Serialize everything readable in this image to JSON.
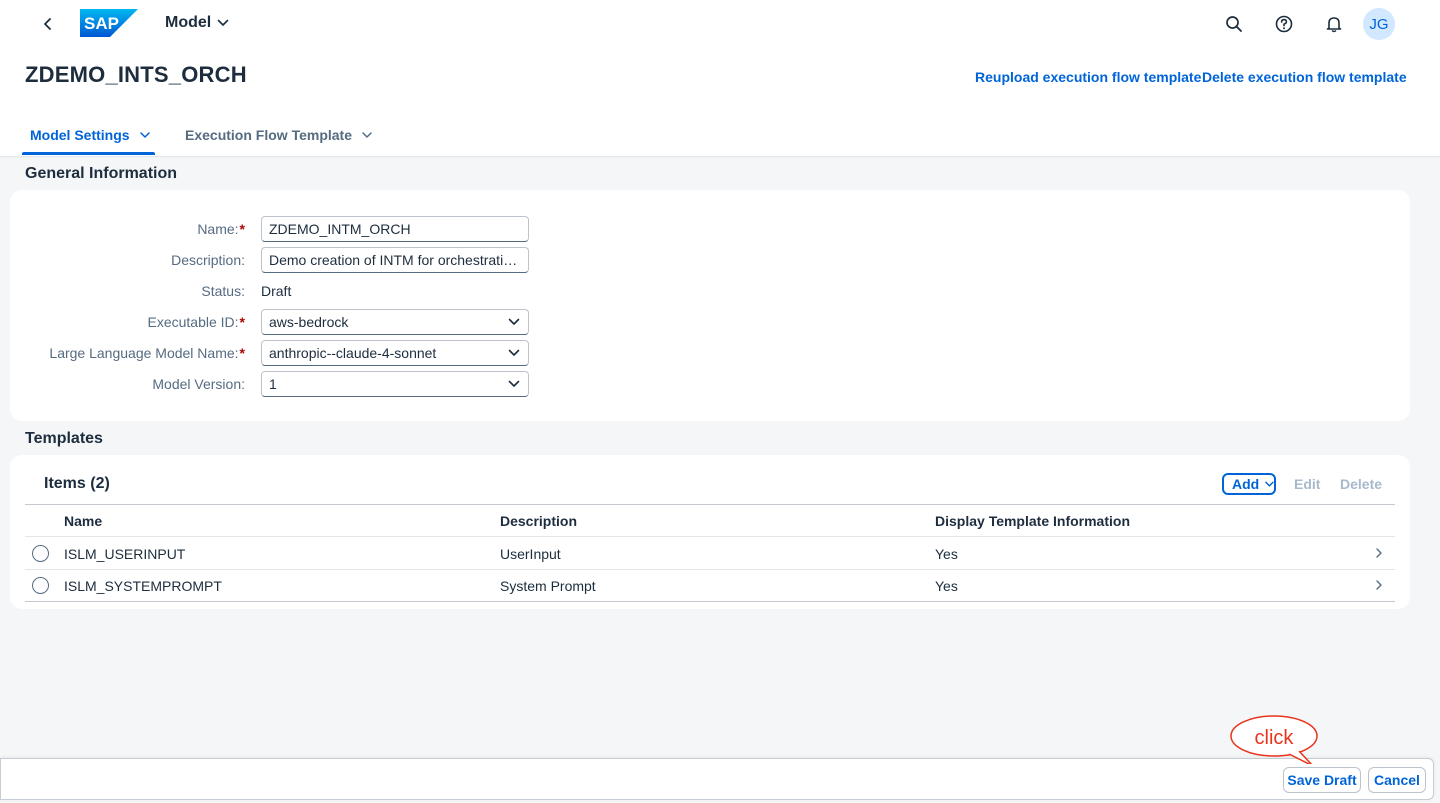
{
  "shell": {
    "brand": "SAP",
    "app_title": "Model",
    "user_initials": "JG",
    "icons": [
      "back-icon",
      "search-icon",
      "help-icon",
      "notifications-icon"
    ]
  },
  "header": {
    "object_title": "ZDEMO_INTS_ORCH",
    "actions": {
      "reupload": "Reupload execution flow template",
      "delete": "Delete execution flow template"
    },
    "tabs": [
      {
        "label": "Model Settings",
        "active": true
      },
      {
        "label": "Execution Flow Template",
        "active": false
      }
    ]
  },
  "general": {
    "section_title": "General Information",
    "fields": {
      "name": {
        "label": "Name:",
        "value": "ZDEMO_INTM_ORCH",
        "required": true
      },
      "description": {
        "label": "Description:",
        "value": "Demo creation of INTM for orchestration...",
        "required": false
      },
      "status": {
        "label": "Status:",
        "value": "Draft"
      },
      "executable_id": {
        "label": "Executable ID:",
        "value": "aws-bedrock",
        "required": true
      },
      "llm_name": {
        "label": "Large Language Model Name:",
        "value": "anthropic--claude-4-sonnet",
        "required": true
      },
      "model_version": {
        "label": "Model Version:",
        "value": "1",
        "required": false
      }
    },
    "required_marker": "*"
  },
  "templates": {
    "section_title": "Templates",
    "table_title": "Items (2)",
    "toolbar": {
      "add": "Add",
      "edit": "Edit",
      "delete": "Delete"
    },
    "columns": [
      "Name",
      "Description",
      "Display Template Information"
    ],
    "rows": [
      {
        "name": "ISLM_USERINPUT",
        "description": "UserInput",
        "display": "Yes"
      },
      {
        "name": "ISLM_SYSTEMPROMPT",
        "description": "System Prompt",
        "display": "Yes"
      }
    ]
  },
  "footer": {
    "save_draft": "Save Draft",
    "cancel": "Cancel"
  },
  "annotation": {
    "text": "click",
    "color": "#e8341c"
  },
  "colors": {
    "accent": "#0064d9",
    "required": "#aa0808",
    "disabled": "#a8b9cc",
    "avatar_bg": "#d1e8ff"
  }
}
